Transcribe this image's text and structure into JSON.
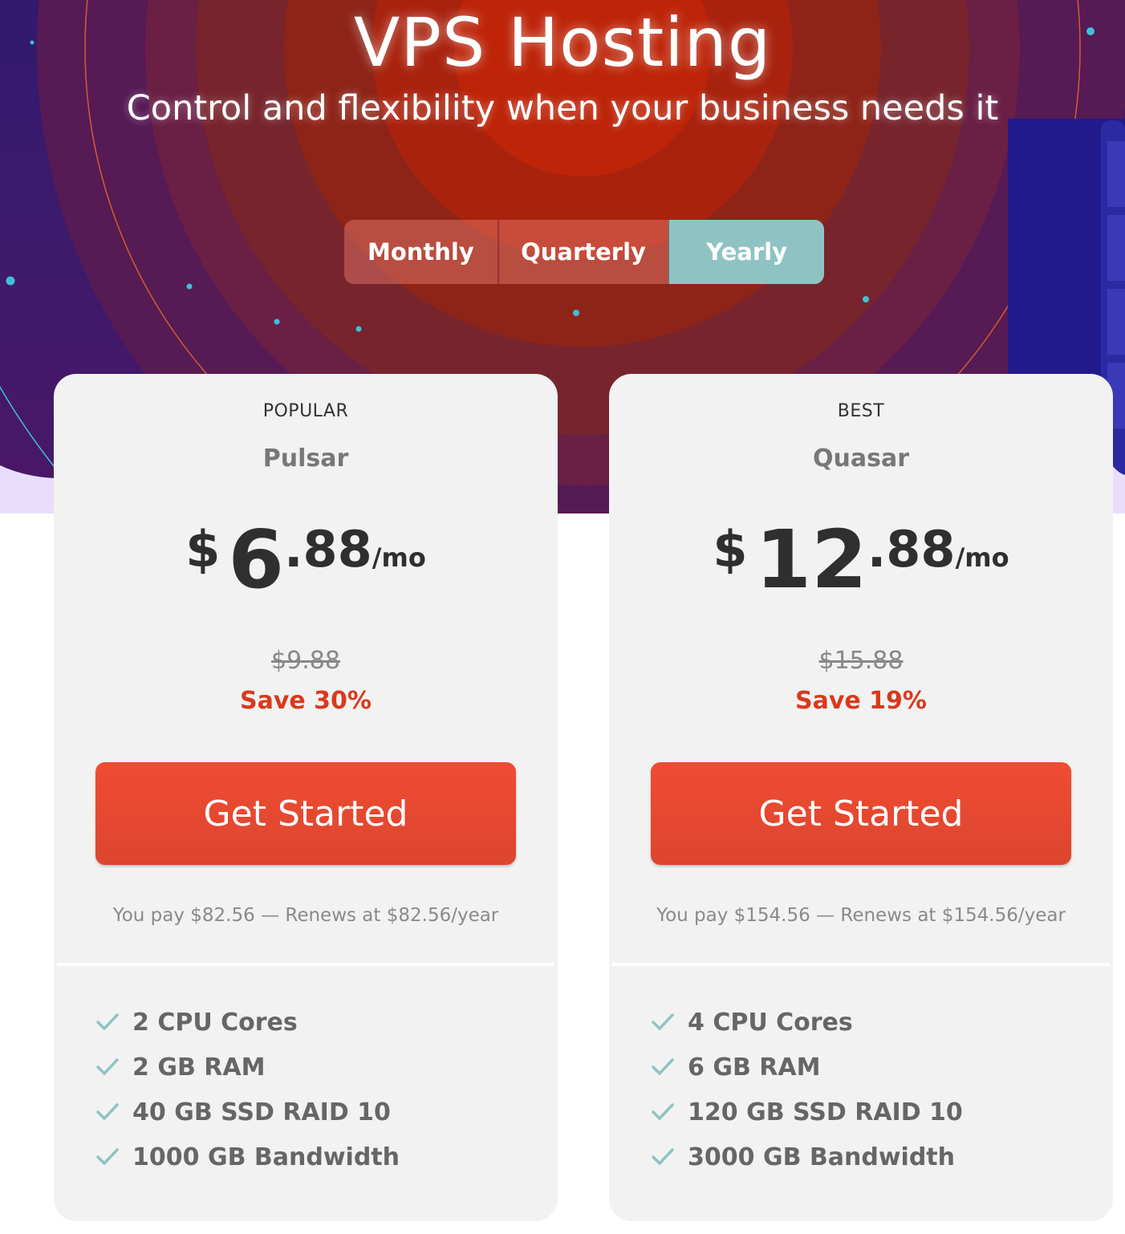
{
  "header": {
    "title": "VPS Hosting",
    "subtitle": "Control and flexibility when your business needs it"
  },
  "billing_toggle": {
    "options": [
      "Monthly",
      "Quarterly",
      "Yearly"
    ],
    "selected": "Yearly"
  },
  "plans": [
    {
      "tag": "POPULAR",
      "name": "Pulsar",
      "currency": "$",
      "price_whole": "6",
      "price_cents": ".88",
      "period": "/mo",
      "old_price": "$9.88",
      "save": "Save 30%",
      "cta": "Get Started",
      "pay_note": "You pay $82.56 — Renews at $82.56/year",
      "features": [
        "2 CPU Cores",
        "2 GB RAM",
        "40 GB SSD RAID 10",
        "1000 GB Bandwidth"
      ]
    },
    {
      "tag": "BEST",
      "name": "Quasar",
      "currency": "$",
      "price_whole": "12",
      "price_cents": ".88",
      "period": "/mo",
      "old_price": "$15.88",
      "save": "Save 19%",
      "cta": "Get Started",
      "pay_note": "You pay $154.56 — Renews at $154.56/year",
      "features": [
        "4 CPU Cores",
        "6 GB RAM",
        "120 GB SSD RAID 10",
        "3000 GB Bandwidth"
      ]
    }
  ],
  "colors": {
    "accent_toggle": "#8fc3c3",
    "cta": "#e64a31",
    "save": "#d9391c",
    "check": "#8fc3c3"
  }
}
